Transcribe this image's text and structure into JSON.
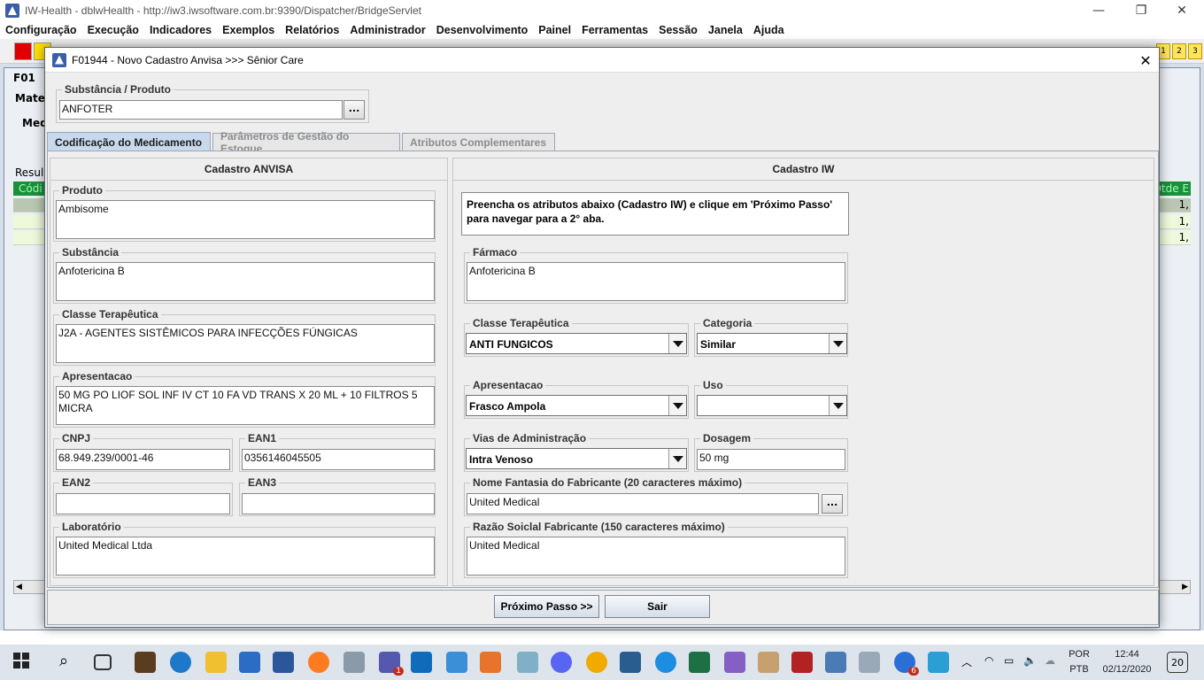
{
  "app": {
    "title": "IW-Health - dblwHealth - http://iw3.iwsoftware.com.br:9390/Dispatcher/BridgeServlet",
    "menu": [
      "Configuração",
      "Execução",
      "Indicadores",
      "Exemplos",
      "Relatórios",
      "Administrador",
      "Desenvolvimento",
      "Painel",
      "Ferramentas",
      "Sessão",
      "Janela",
      "Ajuda"
    ],
    "toolbar_numbers": [
      "1",
      "2",
      "3"
    ],
    "inner_frame": {
      "title_fragment": "F01",
      "left_fragments": [
        "Mater",
        "Med",
        "Resul",
        "Códi"
      ],
      "right_header": "Qtde E",
      "right_values": [
        "1,",
        "1,",
        "1,"
      ]
    }
  },
  "dialog": {
    "title": "F01944 - Novo Cadastro Anvisa >>> Sênior Care",
    "substancia_produto": {
      "label": "Substância / Produto",
      "value": "ANFOTER",
      "button": "..."
    },
    "tabs": [
      "Codificação do Medicamento",
      "Parâmetros de Gestão do Estoque",
      "Atributos Complementares"
    ],
    "anvisa": {
      "header": "Cadastro ANVISA",
      "produto": {
        "label": "Produto",
        "value": "Ambisome"
      },
      "substancia": {
        "label": "Substância",
        "value": "Anfotericina B"
      },
      "classe_terapeutica": {
        "label": "Classe Terapêutica",
        "value": "J2A - AGENTES SISTÊMICOS PARA INFECÇÕES FÚNGICAS"
      },
      "apresentacao": {
        "label": "Apresentacao",
        "value": "50 MG PO LIOF SOL INF IV CT 10 FA VD TRANS X 20 ML + 10 FILTROS 5 MICRA"
      },
      "cnpj": {
        "label": "CNPJ",
        "value": "68.949.239/0001-46"
      },
      "ean1": {
        "label": "EAN1",
        "value": "0356146045505"
      },
      "ean2": {
        "label": "EAN2",
        "value": ""
      },
      "ean3": {
        "label": "EAN3",
        "value": ""
      },
      "laboratorio": {
        "label": "Laboratório",
        "value": "United Medical Ltda"
      }
    },
    "iw": {
      "header": "Cadastro IW",
      "info": "Preencha os atributos abaixo (Cadastro IW) e clique em 'Próximo Passo' para navegar para a 2° aba.",
      "farmaco": {
        "label": "Fármaco",
        "value": "Anfotericina B"
      },
      "classe_terapeutica": {
        "label": "Classe Terapêutica",
        "value": "ANTI FUNGICOS"
      },
      "categoria": {
        "label": "Categoria",
        "value": "Similar"
      },
      "apresentacao": {
        "label": "Apresentacao",
        "value": "Frasco Ampola"
      },
      "uso": {
        "label": "Uso",
        "value": ""
      },
      "vias": {
        "label": "Vias de Administração",
        "value": "Intra Venoso"
      },
      "dosagem": {
        "label": "Dosagem",
        "value": "50 mg"
      },
      "nome_fantasia": {
        "label": "Nome Fantasia do Fabricante (20 caracteres máximo)",
        "value": "United Medical",
        "button": "..."
      },
      "razao_social": {
        "label": "Razão Soiclal Fabricante (150 caracteres máximo)",
        "value": "United Medical"
      }
    },
    "buttons": {
      "next": "Próximo Passo >>",
      "exit": "Sair"
    }
  },
  "taskbar": {
    "lang_top": "POR",
    "lang_bottom": "PTB",
    "time": "12:44",
    "date": "02/12/2020",
    "notif_badge": "20",
    "badge_teams": "1",
    "badge_s": "6"
  }
}
